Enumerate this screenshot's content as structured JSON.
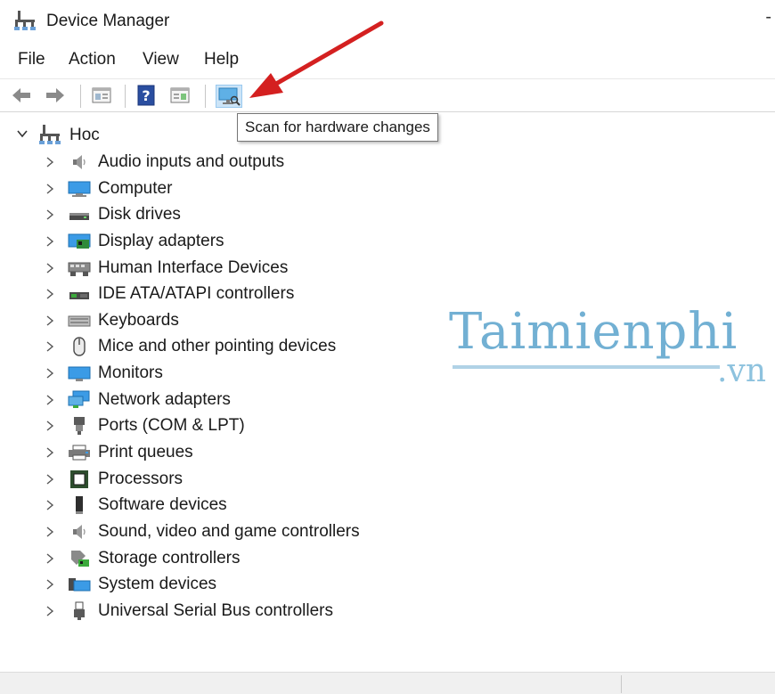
{
  "window": {
    "title": "Device Manager"
  },
  "menu": {
    "items": [
      "File",
      "Action",
      "View",
      "Help"
    ]
  },
  "toolbar": {
    "buttons": [
      "back-icon",
      "forward-icon",
      "properties-icon",
      "help-icon",
      "update-driver-icon",
      "scan-hardware-icon"
    ],
    "tooltip": "Scan for hardware changes"
  },
  "tree": {
    "root_label": "Hoc",
    "items": [
      {
        "label": "Audio inputs and outputs",
        "icon": "speaker-icon"
      },
      {
        "label": "Computer",
        "icon": "computer-icon"
      },
      {
        "label": "Disk drives",
        "icon": "disk-drive-icon"
      },
      {
        "label": "Display adapters",
        "icon": "display-adapter-icon"
      },
      {
        "label": "Human Interface Devices",
        "icon": "hid-icon"
      },
      {
        "label": "IDE ATA/ATAPI controllers",
        "icon": "ide-controller-icon"
      },
      {
        "label": "Keyboards",
        "icon": "keyboard-icon"
      },
      {
        "label": "Mice and other pointing devices",
        "icon": "mouse-icon"
      },
      {
        "label": "Monitors",
        "icon": "monitor-icon"
      },
      {
        "label": "Network adapters",
        "icon": "network-adapter-icon"
      },
      {
        "label": "Ports (COM & LPT)",
        "icon": "port-icon"
      },
      {
        "label": "Print queues",
        "icon": "printer-icon"
      },
      {
        "label": "Processors",
        "icon": "processor-icon"
      },
      {
        "label": "Software devices",
        "icon": "software-device-icon"
      },
      {
        "label": "Sound, video and game controllers",
        "icon": "sound-icon"
      },
      {
        "label": "Storage controllers",
        "icon": "storage-controller-icon"
      },
      {
        "label": "System devices",
        "icon": "system-device-icon"
      },
      {
        "label": "Universal Serial Bus controllers",
        "icon": "usb-icon"
      }
    ]
  },
  "watermark": {
    "main": "Taimienphi",
    "sub": ".vn"
  },
  "colors": {
    "arrow": "#d42020",
    "watermark": "#5aa3cc",
    "toolbar_border": "#d6d6d6"
  }
}
